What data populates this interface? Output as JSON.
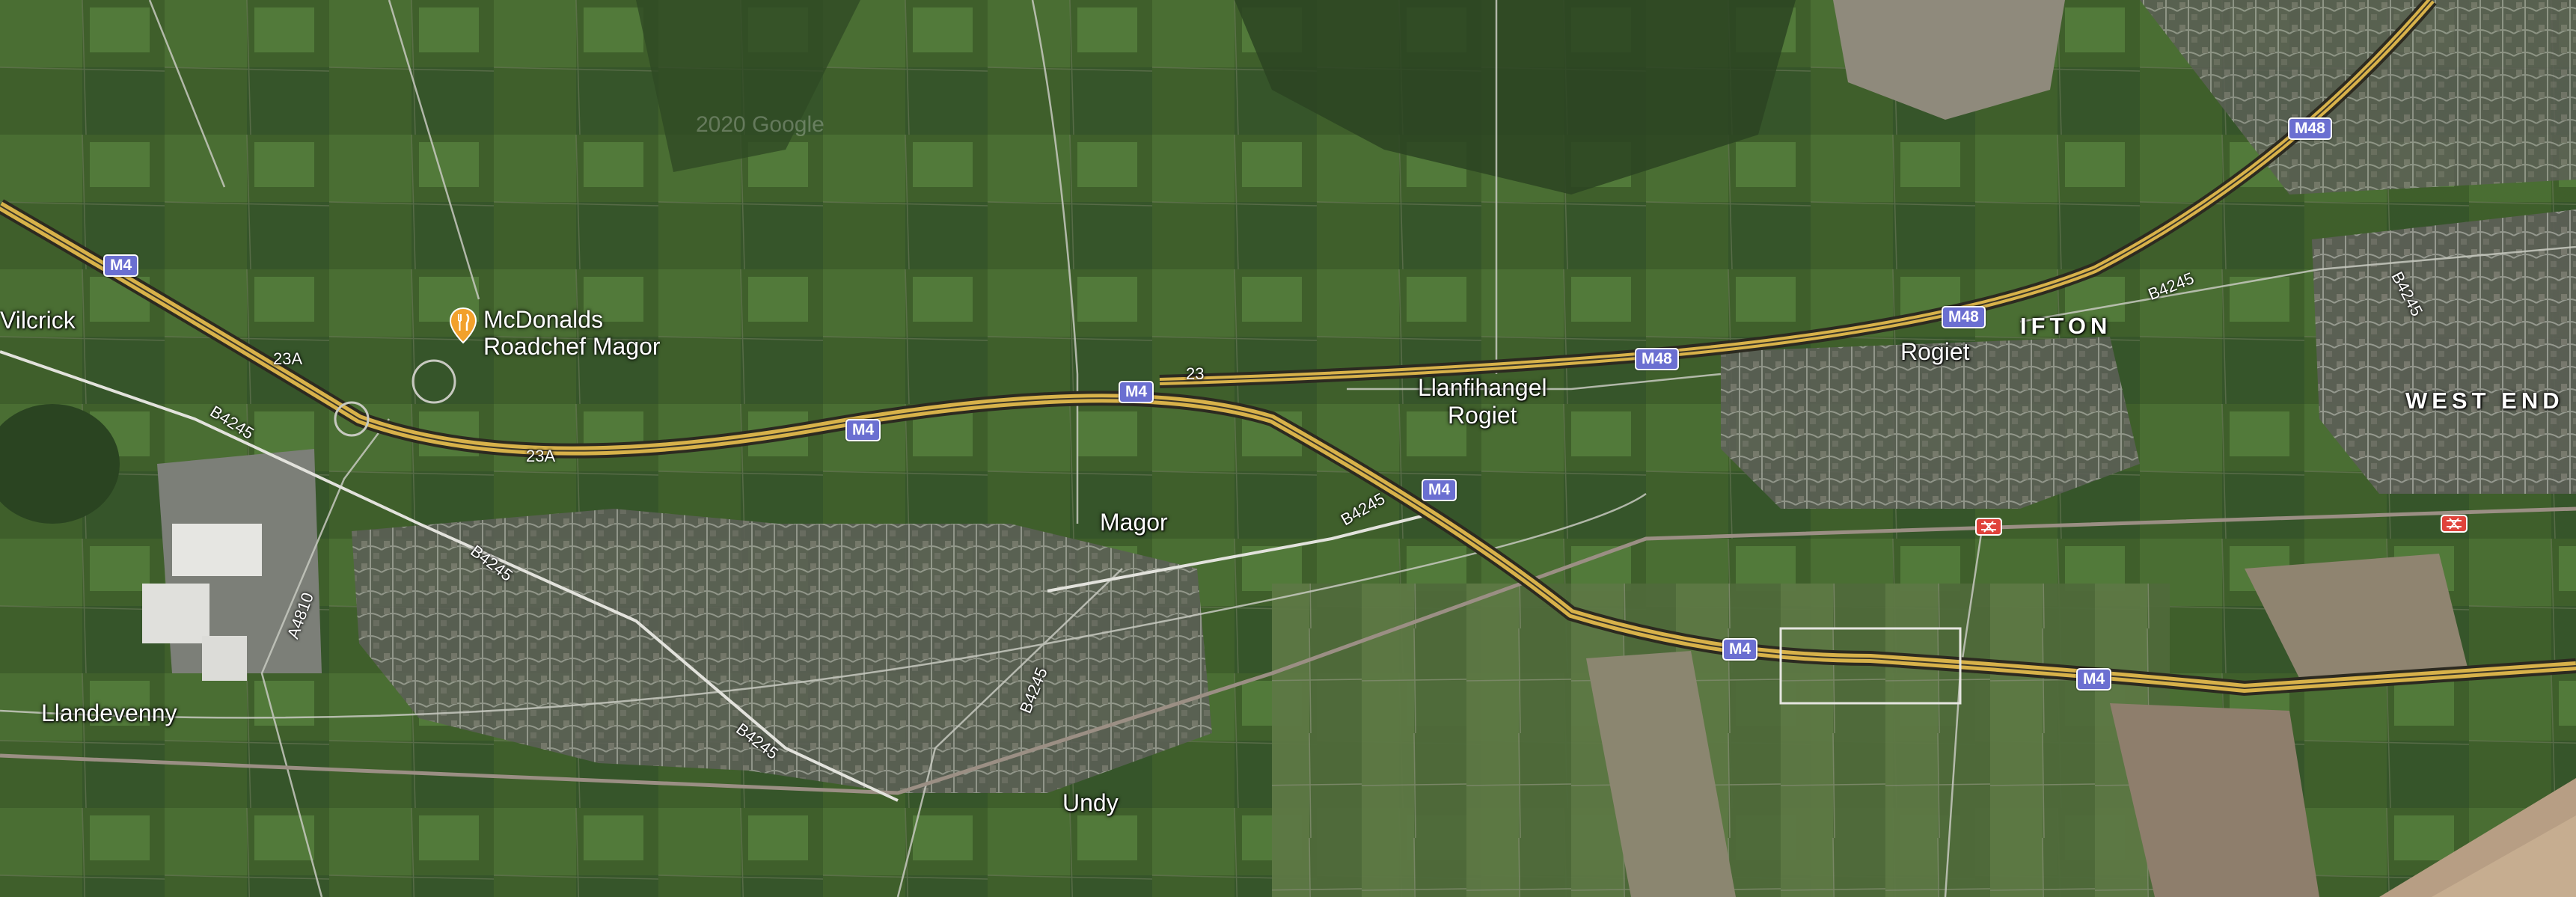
{
  "map": {
    "type": "satellite",
    "poi": {
      "name_line1": "McDonalds",
      "name_line2": "Roadchef Magor",
      "icon": "restaurant-pin-icon",
      "color": "#f2a12c"
    },
    "places": {
      "wilcrick": "Vilcrick",
      "magor": "Magor",
      "llandevenny": "Llandevenny",
      "undy": "Undy",
      "llanfihangel_1": "Llanfihangel",
      "llanfihangel_2": "Rogiet",
      "rogiet": "Rogiet",
      "ifton": "IFTON",
      "west_end": "WEST END"
    },
    "shields": {
      "m4": "M4",
      "m48": "M48"
    },
    "junctions": {
      "j23a": "23A",
      "j23": "23"
    },
    "roads": {
      "b4245": "B4245",
      "a4810": "A4810"
    },
    "watermark": "2020 Google",
    "colors": {
      "motorway": "#d8b24a",
      "shield": "#6b6fd1",
      "rail_icon": "#e0433b"
    }
  }
}
